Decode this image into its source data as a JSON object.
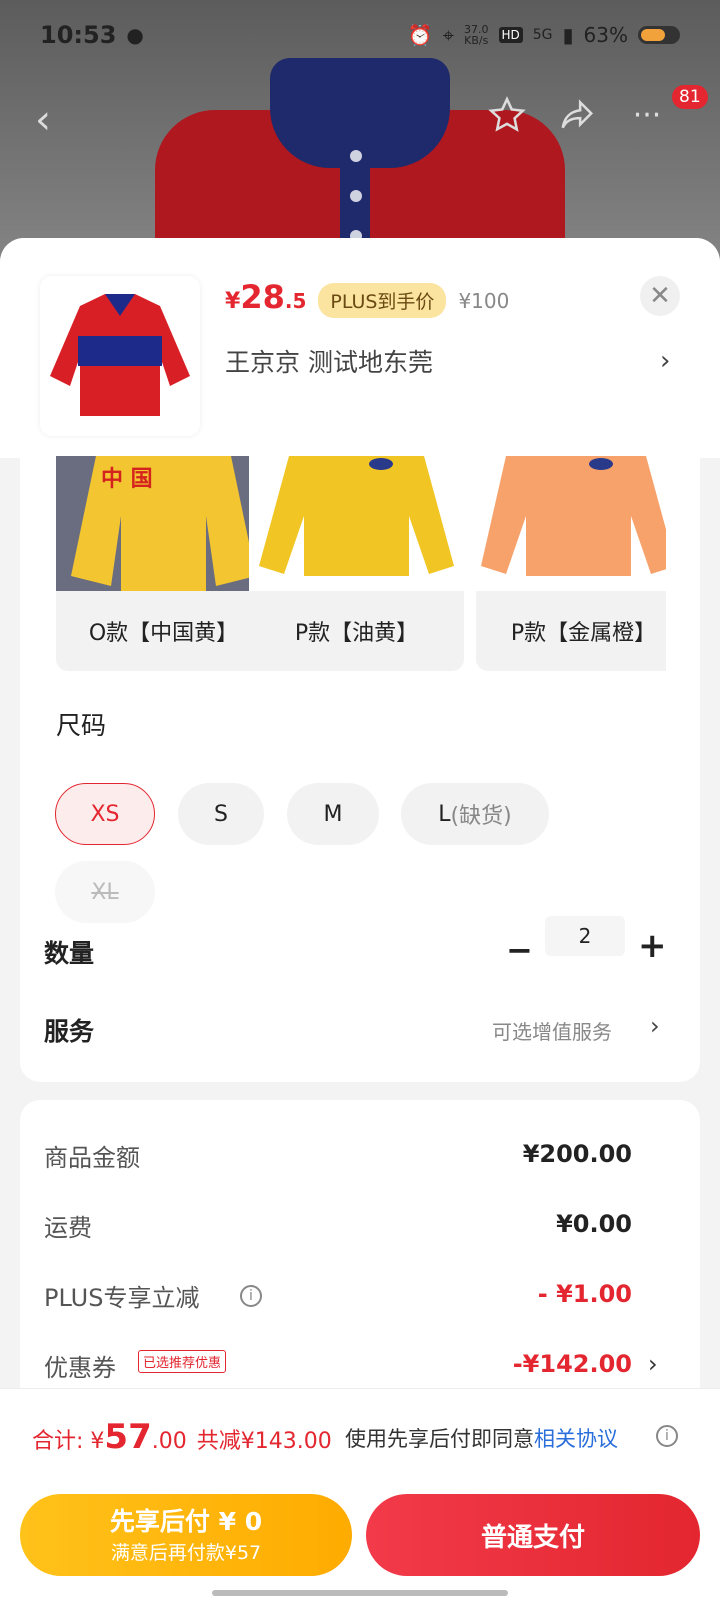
{
  "status_bar": {
    "time": "10:53",
    "net_speed_value": "37.0",
    "net_speed_unit": "KB/s",
    "hd": "HD",
    "signal": "5G",
    "battery": "63%"
  },
  "nav": {
    "badge_count": "81"
  },
  "product": {
    "price_currency": "¥",
    "price_int": "28",
    "price_dec": ".5",
    "plus_tag": "PLUS到手价",
    "original_price": "¥100",
    "address": "王京京  测试地东莞"
  },
  "colors": [
    {
      "label": "O款【中国黄】",
      "color": "#f2c531"
    },
    {
      "label": "P款【油黄】",
      "color": "#f1c523"
    },
    {
      "label": "P款【金属橙】",
      "color": "#f7a26b"
    }
  ],
  "size": {
    "title": "尺码",
    "options": [
      {
        "label": "XS",
        "state": "selected"
      },
      {
        "label": "S",
        "state": "normal"
      },
      {
        "label": "M",
        "state": "normal"
      },
      {
        "label": "L",
        "note": "(缺货)",
        "state": "normal"
      },
      {
        "label": "XL",
        "state": "disabled"
      }
    ]
  },
  "quantity": {
    "label": "数量",
    "value": "2"
  },
  "service": {
    "label": "服务",
    "hint": "可选增值服务"
  },
  "breakdown": {
    "goods_label": "商品金额",
    "goods_value": "¥200.00",
    "shipping_label": "运费",
    "shipping_value": "¥0.00",
    "plus_label": "PLUS专享立减",
    "plus_value": "- ¥1.00",
    "coupon_label": "优惠券",
    "coupon_tag": "已选推荐优惠",
    "coupon_value": "-¥142.00"
  },
  "total": {
    "label": "合计: ¥",
    "amount_int": "57",
    "amount_dec": ".00",
    "saved": "共减¥143.00",
    "agree_text": "使用先享后付即同意",
    "agree_link": "相关协议"
  },
  "buttons": {
    "pay_later_line1": "先享后付 ¥ 0",
    "pay_later_line2": "满意后再付款¥57",
    "pay_normal": "普通支付"
  },
  "theme": {
    "accent": "#e3262f",
    "pay_later": "#ffb300",
    "link": "#2a6edb"
  }
}
